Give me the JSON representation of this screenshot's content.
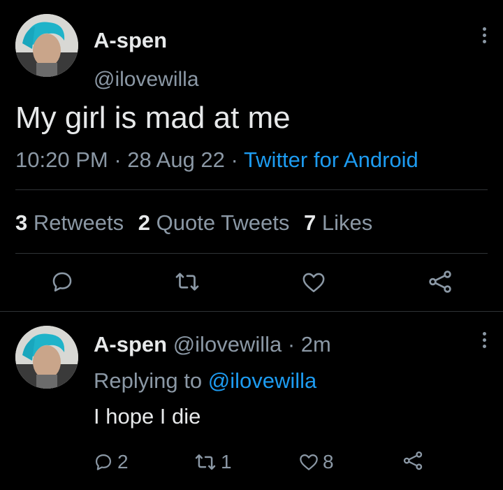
{
  "main_tweet": {
    "display_name": "A-spen",
    "handle": "@ilovewilla",
    "text": "My girl is mad at me",
    "time": "10:20 PM",
    "dot1": "·",
    "date": "28 Aug 22",
    "dot2": "·",
    "source": "Twitter for Android",
    "stats": {
      "retweets_count": "3",
      "retweets_label": "Retweets",
      "quotes_count": "2",
      "quotes_label": "Quote Tweets",
      "likes_count": "7",
      "likes_label": "Likes"
    },
    "actions": {
      "reply_icon": "reply-icon",
      "retweet_icon": "retweet-icon",
      "like_icon": "heart-icon",
      "share_icon": "share-icon"
    }
  },
  "reply_tweet": {
    "display_name": "A-spen",
    "handle": "@ilovewilla",
    "separator": "·",
    "age": "2m",
    "replying_prefix": "Replying to",
    "replying_to": "@ilovewilla",
    "text": "I hope I die",
    "reply_count": "2",
    "retweet_count": "1",
    "like_count": "8"
  },
  "colors": {
    "background": "#000000",
    "text": "#e7e9ea",
    "muted": "#8b98a5",
    "accent": "#1d9bf0",
    "divider": "#2f3336"
  }
}
